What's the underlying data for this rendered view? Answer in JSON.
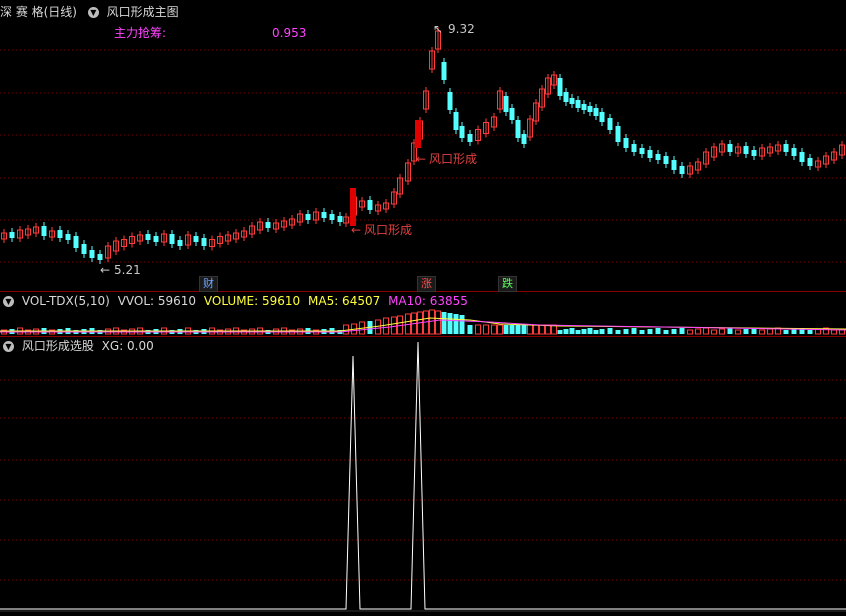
{
  "colors": {
    "up": "#ff3c3c",
    "down": "#54ffff",
    "signal": "#e00000",
    "ma5": "#ffff3c",
    "ma10": "#ff44ff",
    "vol_label": "#c8c8c8",
    "xg_line": "#ffffff",
    "grid": "#7a0000"
  },
  "main_panel": {
    "stock_name": "深 赛 格(日线)",
    "indicator_name": "风口形成主图",
    "stat_label": "主力抢筹:",
    "stat_value": "0.953",
    "high_marker": "9.32",
    "low_marker": "5.21",
    "signal_label": "风口形成",
    "event_badges": [
      {
        "text": "财",
        "color": "#6fa8ff"
      },
      {
        "text": "涨",
        "color": "#ff5050"
      },
      {
        "text": "跌",
        "color": "#5cff5c"
      }
    ]
  },
  "volume_panel": {
    "name": "VOL-TDX(5,10)",
    "vvol_label": "VVOL: 59610",
    "volume_label": "VOLUME: 59610",
    "ma5_label": "MA5: 64507",
    "ma10_label": "MA10: 63855"
  },
  "xg_panel": {
    "name": "风口形成选股",
    "xg_label": "XG: 0.00",
    "signal_values": [
      0,
      1,
      0,
      1,
      0
    ]
  },
  "icons": {
    "collapse": "chevron-down-circle-icon",
    "marker": "arrow-left-icon"
  }
}
